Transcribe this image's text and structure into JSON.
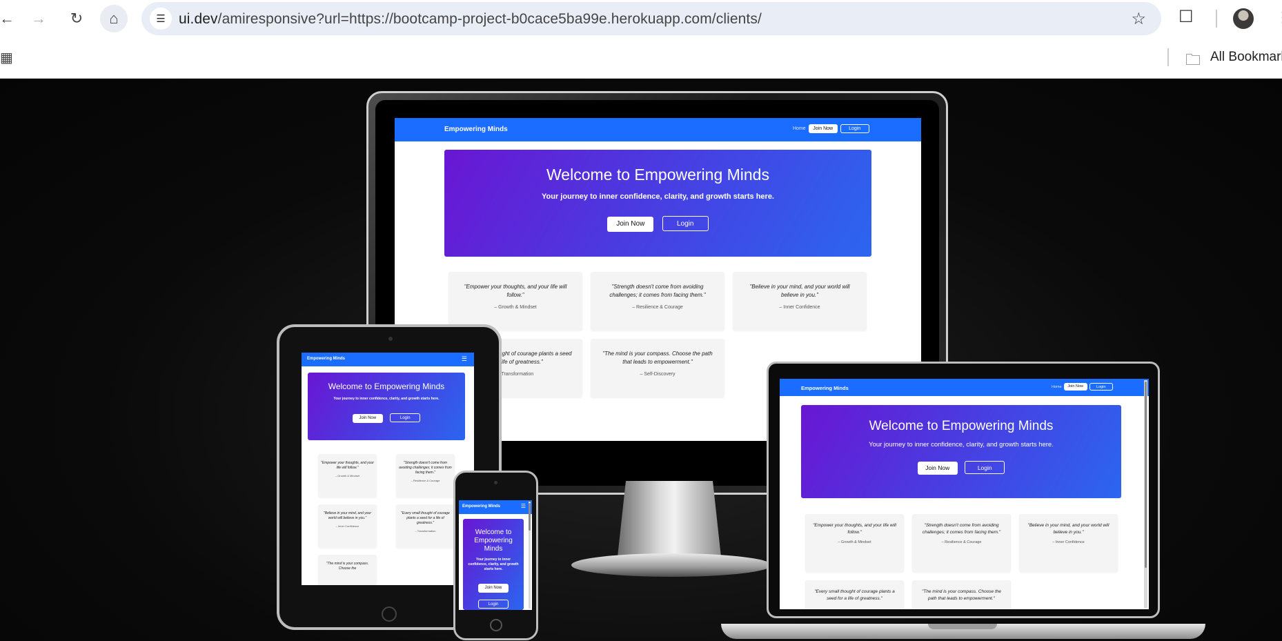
{
  "browser": {
    "url_host": "ui.dev",
    "url_path": "/amiresponsive?url=https://bootcamp-project-b0cace5ba99e.herokuapp.com/clients/",
    "bookmarks_label": "All Bookmark"
  },
  "site": {
    "brand": "Empowering Minds",
    "nav_home": "Home",
    "nav_join": "Join Now",
    "nav_login": "Login",
    "hero_title": "Welcome to Empowering Minds",
    "hero_title_phone_1": "Welcome to",
    "hero_title_phone_2": "Empowering",
    "hero_title_phone_3": "Minds",
    "hero_subtitle": "Your journey to inner confidence, clarity, and growth starts here.",
    "hero_join": "Join Now",
    "hero_login": "Login",
    "quotes": [
      {
        "text": "\"Empower your thoughts, and your life will follow.\"",
        "author": "– Growth & Mindset"
      },
      {
        "text": "\"Strength doesn't come from avoiding challenges; it comes from facing them.\"",
        "author": "– Resilience & Courage"
      },
      {
        "text": "\"Believe in your mind, and your world will believe in you.\"",
        "author": "– Inner Confidence"
      },
      {
        "text": "\"Every small thought of courage plants a seed for a life of greatness.\"",
        "author": "– Transformation"
      },
      {
        "text": "\"The mind is your compass. Choose the path that leads to empowerment.\"",
        "author": "– Self-Discovery"
      }
    ],
    "monitor_q4_text": "...ought of courage plants a ...a life of greatness.\"",
    "monitor_q4_author": "...Transformation",
    "tablet_q5_text": "\"The mind is your compass. Choose the",
    "laptop_q4_text": "\"Every small thought of courage plants a seed for a life of greatness.\"",
    "laptop_q5_text": "\"The mind is your compass. Choose the path that leads to empowerment.\""
  }
}
